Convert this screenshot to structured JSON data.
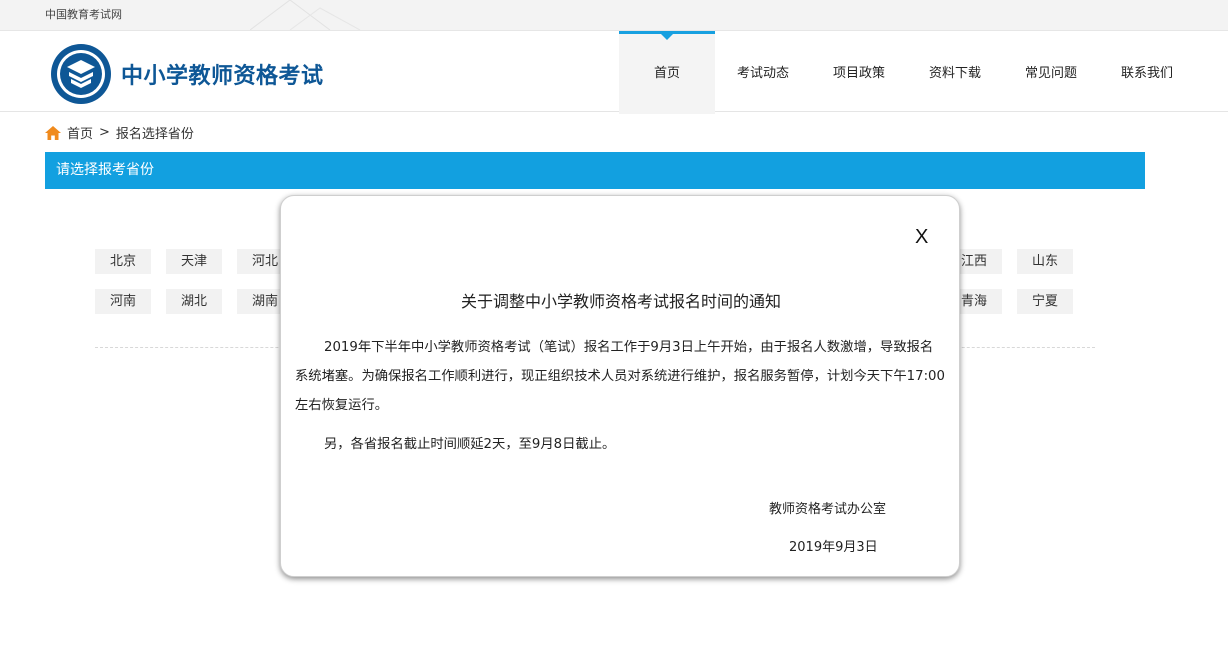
{
  "topbar": {
    "site_name": "中国教育考试网"
  },
  "header": {
    "brand": "中小学教师资格考试",
    "nav": [
      {
        "label": "首页",
        "active": true
      },
      {
        "label": "考试动态",
        "active": false
      },
      {
        "label": "项目政策",
        "active": false
      },
      {
        "label": "资料下载",
        "active": false
      },
      {
        "label": "常见问题",
        "active": false
      },
      {
        "label": "联系我们",
        "active": false
      }
    ]
  },
  "breadcrumb": {
    "home": "首页",
    "separator": ">",
    "current": "报名选择省份"
  },
  "section": {
    "title": "请选择报考省份"
  },
  "provinces": {
    "row1": [
      "北京",
      "天津",
      "河北",
      "江西",
      "山东"
    ],
    "row2": [
      "河南",
      "湖北",
      "湖南",
      "青海",
      "宁夏"
    ]
  },
  "modal": {
    "close": "X",
    "title": "关于调整中小学教师资格考试报名时间的通知",
    "paragraph1": "2019年下半年中小学教师资格考试（笔试）报名工作于9月3日上午开始，由于报名人数激增，导致报名系统堵塞。为确保报名工作顺利进行，现正组织技术人员对系统进行维护，报名服务暂停，计划今天下午17:00左右恢复运行。",
    "paragraph2": "另，各省报名截止时间顺延2天，至9月8日截止。",
    "signature": "教师资格考试办公室",
    "date": "2019年9月3日"
  },
  "colors": {
    "accent": "#12a0e0",
    "brand": "#0e5796",
    "home_icon": "#f08a1c"
  }
}
